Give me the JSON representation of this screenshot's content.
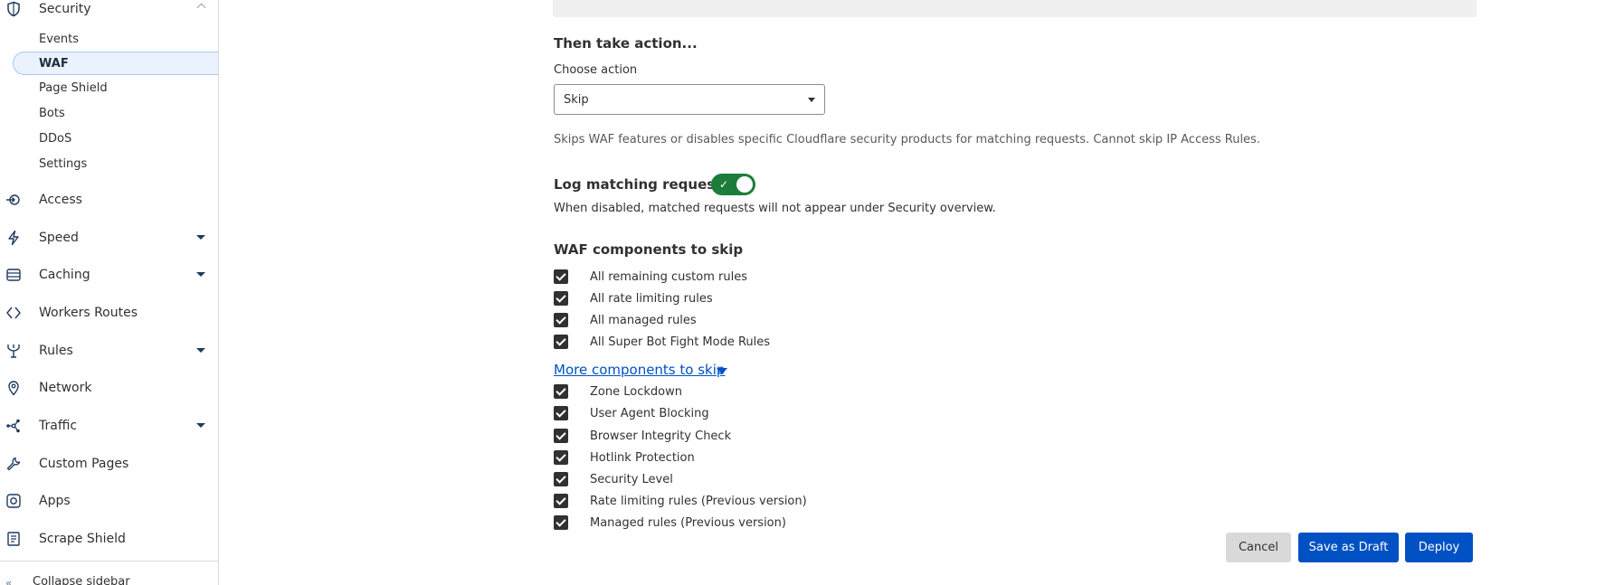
{
  "sidebar": {
    "sections_top": [
      {
        "label": "Security",
        "icon": "shield-icon"
      }
    ],
    "security_items": [
      {
        "label": "Events"
      },
      {
        "label": "WAF"
      },
      {
        "label": "Page Shield"
      },
      {
        "label": "Bots"
      },
      {
        "label": "DDoS"
      },
      {
        "label": "Settings"
      }
    ],
    "sections": [
      {
        "label": "Access",
        "icon": "access-icon"
      },
      {
        "label": "Speed",
        "icon": "lightning-icon"
      },
      {
        "label": "Caching",
        "icon": "caching-icon"
      },
      {
        "label": "Workers Routes",
        "icon": "workers-icon"
      },
      {
        "label": "Rules",
        "icon": "rules-icon"
      },
      {
        "label": "Network",
        "icon": "location-pin-icon"
      },
      {
        "label": "Traffic",
        "icon": "traffic-icon"
      },
      {
        "label": "Custom Pages",
        "icon": "wrench-icon"
      },
      {
        "label": "Apps",
        "icon": "apps-icon"
      },
      {
        "label": "Scrape Shield",
        "icon": "document-icon"
      }
    ],
    "collapse_label": "Collapse sidebar"
  },
  "main": {
    "action_heading": "Then take action...",
    "choose_action_label": "Choose action",
    "selected_action": "Skip",
    "action_help": "Skips WAF features or disables specific Cloudflare security products for matching requests. Cannot skip IP Access Rules.",
    "log_label": "Log matching requests",
    "log_enabled": true,
    "log_help": "When disabled, matched requests will not appear under Security overview.",
    "components_title": "WAF components to skip",
    "components": [
      {
        "label": "All remaining custom rules",
        "checked": true
      },
      {
        "label": "All rate limiting rules",
        "checked": true
      },
      {
        "label": "All managed rules",
        "checked": true
      },
      {
        "label": "All Super Bot Fight Mode Rules",
        "checked": true
      }
    ],
    "more_link": "More components to skip",
    "more_components": [
      {
        "label": "Zone Lockdown",
        "checked": true
      },
      {
        "label": "User Agent Blocking",
        "checked": true
      },
      {
        "label": "Browser Integrity Check",
        "checked": true
      },
      {
        "label": "Hotlink Protection",
        "checked": true
      },
      {
        "label": "Security Level",
        "checked": true
      },
      {
        "label": "Rate limiting rules (Previous version)",
        "checked": true
      },
      {
        "label": "Managed rules (Previous version)",
        "checked": true
      }
    ],
    "buttons": {
      "cancel": "Cancel",
      "draft": "Save as Draft",
      "deploy": "Deploy"
    }
  },
  "colors": {
    "accent": "#0051c3",
    "toggle_on": "#1c7d3a",
    "active_bg": "#eaf2fd"
  }
}
